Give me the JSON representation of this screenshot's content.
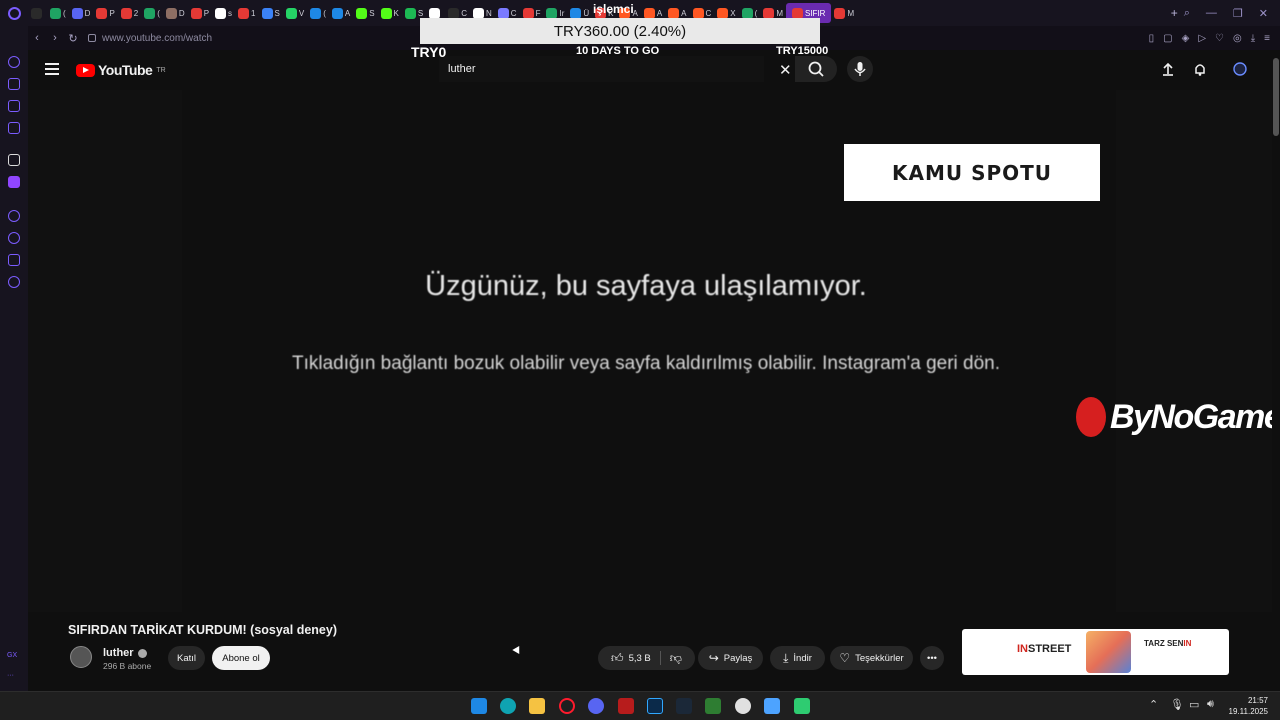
{
  "browser": {
    "tabs": [
      {
        "label": "",
        "color": "#2a2a2a"
      },
      {
        "label": "(",
        "color": "#1fa463"
      },
      {
        "label": "D",
        "color": "#5865f2"
      },
      {
        "label": "P",
        "color": "#e53935"
      },
      {
        "label": "2",
        "color": "#e53935"
      },
      {
        "label": "(",
        "color": "#1fa463"
      },
      {
        "label": "D",
        "color": "#8d6e63"
      },
      {
        "label": "P",
        "color": "#e53935"
      },
      {
        "label": "s",
        "color": "#ffffff"
      },
      {
        "label": "1",
        "color": "#e53935"
      },
      {
        "label": "S",
        "color": "#3b82f6"
      },
      {
        "label": "V",
        "color": "#25d366"
      },
      {
        "label": "(",
        "color": "#1e88e5"
      },
      {
        "label": "A",
        "color": "#1e88e5"
      },
      {
        "label": "S",
        "color": "#53fc18"
      },
      {
        "label": "K",
        "color": "#53fc18"
      },
      {
        "label": "S",
        "color": "#1db954"
      },
      {
        "label": "",
        "color": "#ffffff"
      },
      {
        "label": "C",
        "color": "#2a2a2a"
      },
      {
        "label": "N",
        "color": "#ffffff"
      },
      {
        "label": "C",
        "color": "#7a7aff"
      },
      {
        "label": "F",
        "color": "#e53935"
      },
      {
        "label": "Ir",
        "color": "#1fa463"
      },
      {
        "label": "Ü",
        "color": "#1e88e5"
      },
      {
        "label": "K",
        "color": "#e53935"
      },
      {
        "label": "A",
        "color": "#ff5722"
      },
      {
        "label": "A",
        "color": "#ff5722"
      },
      {
        "label": "A",
        "color": "#ff5722"
      },
      {
        "label": "C",
        "color": "#ff5722"
      },
      {
        "label": "X",
        "color": "#ff5722"
      },
      {
        "label": "(",
        "color": "#1fa463"
      },
      {
        "label": "M",
        "color": "#e53935"
      },
      {
        "label": "SIFIR",
        "color": "#e53935",
        "active": true
      },
      {
        "label": "M",
        "color": "#e53935"
      }
    ],
    "url": "www.youtube.com/watch"
  },
  "youtube": {
    "logo_text": "YouTube",
    "region": "TR",
    "search_value": "luther",
    "video": {
      "error_title": "Üzgünüz, bu sayfaya ulaşılamıyor.",
      "error_message": "Tıkladığın bağlantı bozuk olabilir veya sayfa kaldırılmış olabilir. Instagram'a geri dön.",
      "overlay_banner": "KAMU SPOTU",
      "sponsor_logo": "ByNoGame",
      "donation": {
        "brand": "işlemci",
        "amount": "TRY360.00 (2.40%)",
        "left": "TRY0",
        "center": "10 DAYS TO GO",
        "right": "TRY15000"
      }
    },
    "title": "SIFIRDAN TARİKAT KURDUM! (sosyal deney)",
    "channel": {
      "name": "luther",
      "subscribers": "296 B abone",
      "join_label": "Katıl",
      "subscribe_label": "Abone ol"
    },
    "actions": {
      "likes": "5,3 B",
      "share": "Paylaş",
      "download": "İndir",
      "thanks": "Teşekkürler"
    },
    "ad": {
      "brand": "IN",
      "brand_suffix": "STREET",
      "slogan_prefix": "TARZ SEN",
      "slogan_suffix": "IN"
    }
  },
  "taskbar": {
    "time": "21:57",
    "date": "19.11.2025"
  }
}
